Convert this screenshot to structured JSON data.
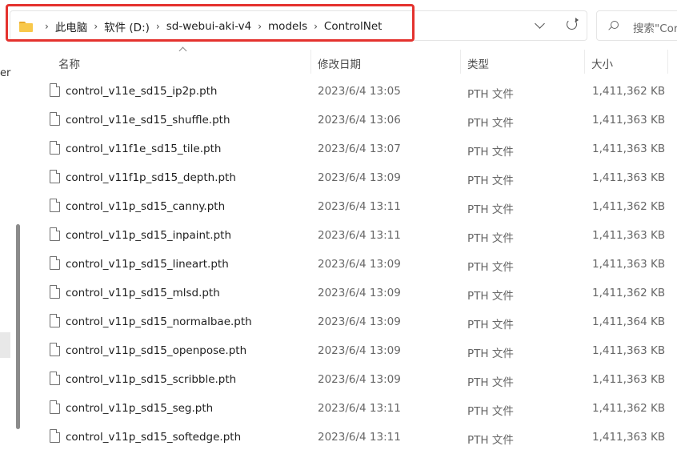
{
  "breadcrumb": {
    "items": [
      "此电脑",
      "软件 (D:)",
      "sd-webui-aki-v4",
      "models",
      "ControlNet"
    ]
  },
  "search": {
    "placeholder": "搜索\"Cor"
  },
  "left_pane": {
    "fragment": "ers"
  },
  "columns": {
    "name": "名称",
    "date": "修改日期",
    "type": "类型",
    "size": "大小"
  },
  "files": [
    {
      "name": "control_v11e_sd15_ip2p.pth",
      "date": "2023/6/4 13:05",
      "type": "PTH 文件",
      "size": "1,411,362 KB"
    },
    {
      "name": "control_v11e_sd15_shuffle.pth",
      "date": "2023/6/4 13:06",
      "type": "PTH 文件",
      "size": "1,411,363 KB"
    },
    {
      "name": "control_v11f1e_sd15_tile.pth",
      "date": "2023/6/4 13:07",
      "type": "PTH 文件",
      "size": "1,411,363 KB"
    },
    {
      "name": "control_v11f1p_sd15_depth.pth",
      "date": "2023/6/4 13:09",
      "type": "PTH 文件",
      "size": "1,411,363 KB"
    },
    {
      "name": "control_v11p_sd15_canny.pth",
      "date": "2023/6/4 13:11",
      "type": "PTH 文件",
      "size": "1,411,362 KB"
    },
    {
      "name": "control_v11p_sd15_inpaint.pth",
      "date": "2023/6/4 13:11",
      "type": "PTH 文件",
      "size": "1,411,363 KB"
    },
    {
      "name": "control_v11p_sd15_lineart.pth",
      "date": "2023/6/4 13:09",
      "type": "PTH 文件",
      "size": "1,411,363 KB"
    },
    {
      "name": "control_v11p_sd15_mlsd.pth",
      "date": "2023/6/4 13:09",
      "type": "PTH 文件",
      "size": "1,411,362 KB"
    },
    {
      "name": "control_v11p_sd15_normalbae.pth",
      "date": "2023/6/4 13:09",
      "type": "PTH 文件",
      "size": "1,411,364 KB"
    },
    {
      "name": "control_v11p_sd15_openpose.pth",
      "date": "2023/6/4 13:09",
      "type": "PTH 文件",
      "size": "1,411,363 KB"
    },
    {
      "name": "control_v11p_sd15_scribble.pth",
      "date": "2023/6/4 13:09",
      "type": "PTH 文件",
      "size": "1,411,363 KB"
    },
    {
      "name": "control_v11p_sd15_seg.pth",
      "date": "2023/6/4 13:11",
      "type": "PTH 文件",
      "size": "1,411,362 KB"
    },
    {
      "name": "control_v11p_sd15_softedge.pth",
      "date": "2023/6/4 13:11",
      "type": "PTH 文件",
      "size": "1,411,363 KB"
    }
  ],
  "colors": {
    "highlight": "#e4322e",
    "folder": "#f8c84b"
  },
  "icons": [
    "folder-icon",
    "chevron-down-icon",
    "refresh-icon",
    "search-icon",
    "file-icon"
  ]
}
